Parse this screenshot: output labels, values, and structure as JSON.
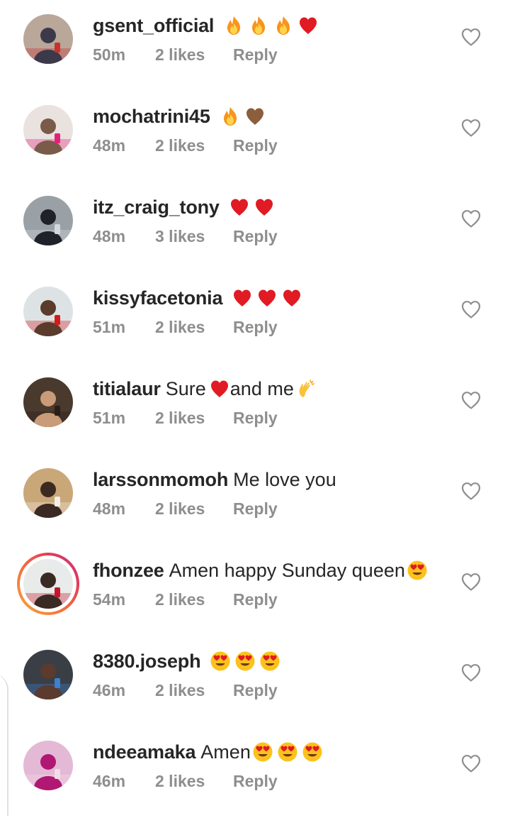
{
  "comments": [
    {
      "username": "gsent_official",
      "text": "",
      "emojis": [
        "fire",
        "fire",
        "fire",
        "red-heart"
      ],
      "time": "50m",
      "likes": "2 likes",
      "reply": "Reply",
      "avatar": {
        "bg": "#b9a79a",
        "fg": "#3c3a4a",
        "accent": "#c8322d"
      }
    },
    {
      "username": "mochatrini45",
      "text": "",
      "emojis": [
        "fire",
        "brown-heart"
      ],
      "time": "48m",
      "likes": "2 likes",
      "reply": "Reply",
      "avatar": {
        "bg": "#e9e2df",
        "fg": "#7a5a48",
        "accent": "#e2217b"
      }
    },
    {
      "username": "itz_craig_tony",
      "text": "",
      "emojis": [
        "red-heart",
        "red-heart"
      ],
      "time": "48m",
      "likes": "3 likes",
      "reply": "Reply",
      "avatar": {
        "bg": "#9aa1a6",
        "fg": "#1f2228",
        "accent": "#d5d8da"
      }
    },
    {
      "username": "kissyfacetonia",
      "text": "",
      "emojis": [
        "red-heart",
        "red-heart",
        "red-heart"
      ],
      "time": "51m",
      "likes": "2 likes",
      "reply": "Reply",
      "avatar": {
        "bg": "#dde3e5",
        "fg": "#5a3b2c",
        "accent": "#d11c1c"
      }
    },
    {
      "username": "titialaur",
      "text": "Sure",
      "emojis_mid": [
        "red-heart"
      ],
      "text2": "and me",
      "emojis": [
        "clapping-hands"
      ],
      "time": "51m",
      "likes": "2 likes",
      "reply": "Reply",
      "avatar": {
        "bg": "#4a3a2e",
        "fg": "#c99b78",
        "accent": "#2b1e16"
      }
    },
    {
      "username": "larssonmomoh",
      "text": "Me love you",
      "emojis": [],
      "time": "48m",
      "likes": "2 likes",
      "reply": "Reply",
      "avatar": {
        "bg": "#c9a778",
        "fg": "#3a2a22",
        "accent": "#f2efe8"
      }
    },
    {
      "username": "fhonzee",
      "text": "Amen happy Sunday queen",
      "emojis": [
        "heart-eyes"
      ],
      "time": "54m",
      "likes": "2 likes",
      "reply": "Reply",
      "story": true,
      "avatar": {
        "bg": "#e8ebe9",
        "fg": "#3a2a24",
        "accent": "#c4152b"
      }
    },
    {
      "username": "8380.joseph",
      "text": "",
      "emojis": [
        "heart-eyes",
        "heart-eyes",
        "heart-eyes"
      ],
      "time": "46m",
      "likes": "2 likes",
      "reply": "Reply",
      "avatar": {
        "bg": "#3a3f46",
        "fg": "#5a3b2e",
        "accent": "#3f7fd0"
      }
    },
    {
      "username": "ndeeamaka",
      "text": "Amen",
      "emojis": [
        "heart-eyes",
        "heart-eyes",
        "heart-eyes"
      ],
      "time": "46m",
      "likes": "2 likes",
      "reply": "Reply",
      "avatar": {
        "bg": "#e3b9d6",
        "fg": "#b01873",
        "accent": "#f3dce8"
      }
    }
  ],
  "icons": {
    "like": "heart-outline-icon"
  },
  "colors": {
    "username": "#262626",
    "meta": "#8e8e8e",
    "heart_icon": "#8e8e8e"
  }
}
